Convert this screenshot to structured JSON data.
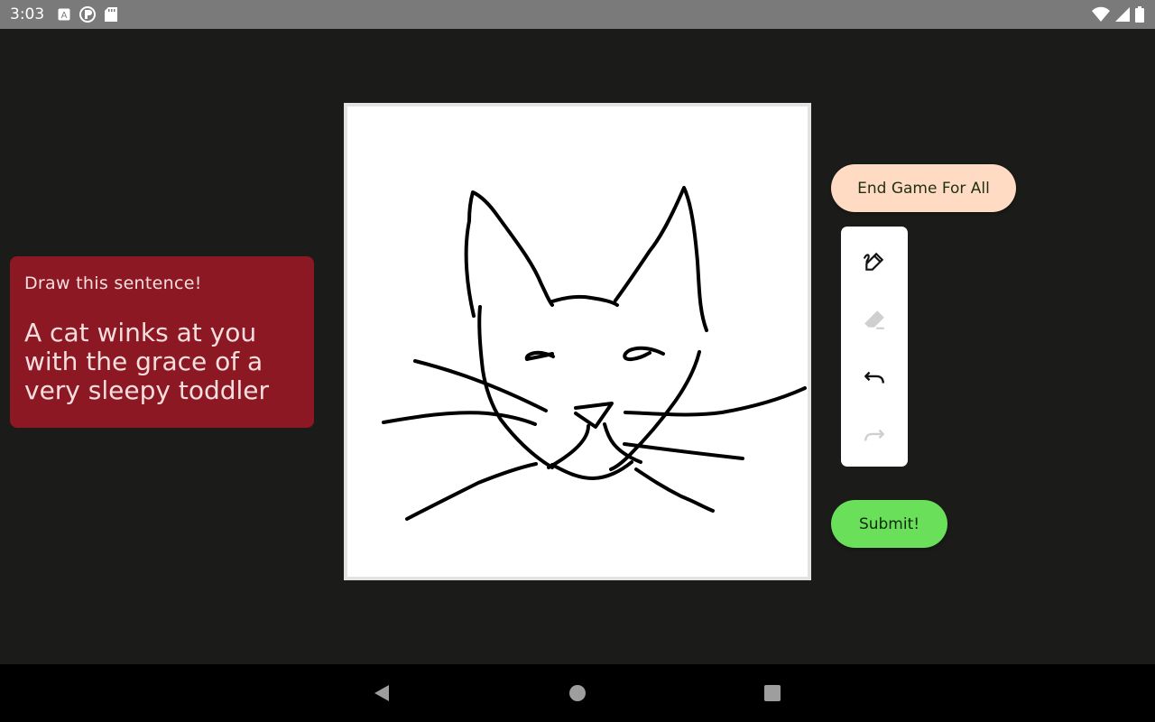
{
  "status_bar": {
    "time": "3:03",
    "left_icons": [
      "a-icon",
      "sync-icon",
      "sd-card-icon"
    ],
    "right_icons": [
      "wifi-icon",
      "cell-signal-icon",
      "battery-icon"
    ]
  },
  "prompt": {
    "heading": "Draw this sentence!",
    "sentence": "A cat winks at you with the grace of a very sleepy toddler"
  },
  "buttons": {
    "end_game": "End Game For All",
    "submit": "Submit!"
  },
  "tools": [
    {
      "name": "pen",
      "icon": "pen-icon",
      "enabled": true
    },
    {
      "name": "eraser",
      "icon": "eraser-icon",
      "enabled": false
    },
    {
      "name": "undo",
      "icon": "undo-icon",
      "enabled": true
    },
    {
      "name": "redo",
      "icon": "redo-icon",
      "enabled": false
    }
  ],
  "colors": {
    "background": "#1b1c19",
    "prompt_card": "#8c1823",
    "end_game_button": "#ffdbc4",
    "submit_button": "#6adf59",
    "status_bar": "#7a7a7a"
  },
  "nav_bar": [
    "back-icon",
    "home-icon",
    "recents-icon"
  ]
}
